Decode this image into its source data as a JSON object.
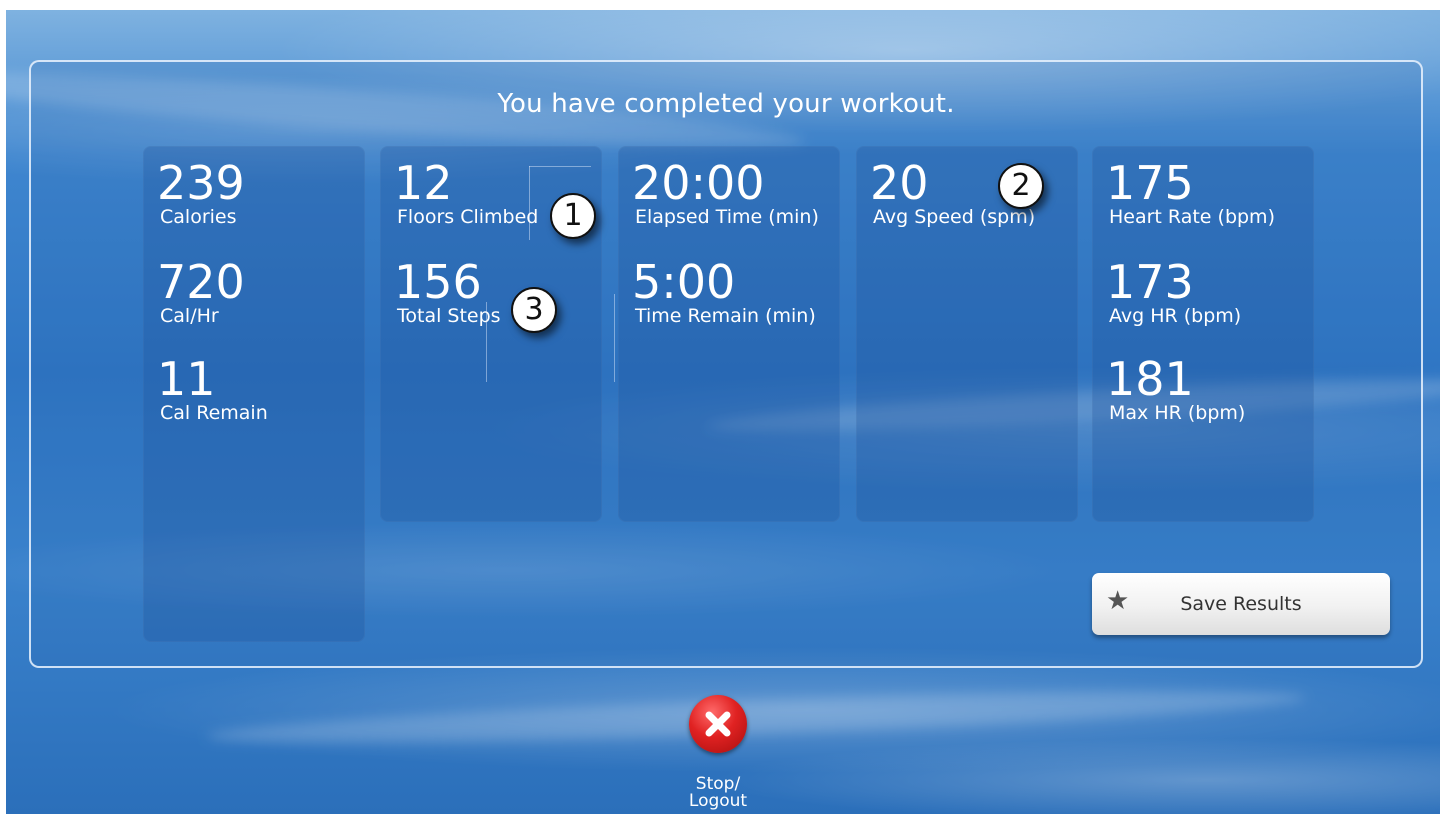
{
  "header": {
    "title": "You have completed your workout."
  },
  "columns": [
    {
      "stats": [
        {
          "value": "239",
          "label": "Calories"
        },
        {
          "value": "720",
          "label": "Cal/Hr"
        },
        {
          "value": "11",
          "label": "Cal Remain"
        }
      ]
    },
    {
      "stats": [
        {
          "value": "12",
          "label": "Floors Climbed"
        },
        {
          "value": "156",
          "label": "Total Steps"
        }
      ]
    },
    {
      "stats": [
        {
          "value": "20:00",
          "label": "Elapsed Time (min)"
        },
        {
          "value": "5:00",
          "label": "Time Remain (min)"
        }
      ]
    },
    {
      "stats": [
        {
          "value": "20",
          "label": "Avg Speed (spm)"
        }
      ]
    },
    {
      "stats": [
        {
          "value": "175",
          "label": "Heart Rate (bpm)"
        },
        {
          "value": "173",
          "label": "Avg HR (bpm)"
        },
        {
          "value": "181",
          "label": "Max HR (bpm)"
        }
      ]
    }
  ],
  "callouts": [
    "1",
    "2",
    "3"
  ],
  "actions": {
    "save_label": "Save Results",
    "save_icon": "star-icon",
    "stop_label_line1": "Stop/",
    "stop_label_line2": "Logout",
    "stop_icon": "close-x-icon"
  },
  "colors": {
    "background": "#3f86cf",
    "stop_button": "#e02222",
    "text": "#ffffff"
  }
}
